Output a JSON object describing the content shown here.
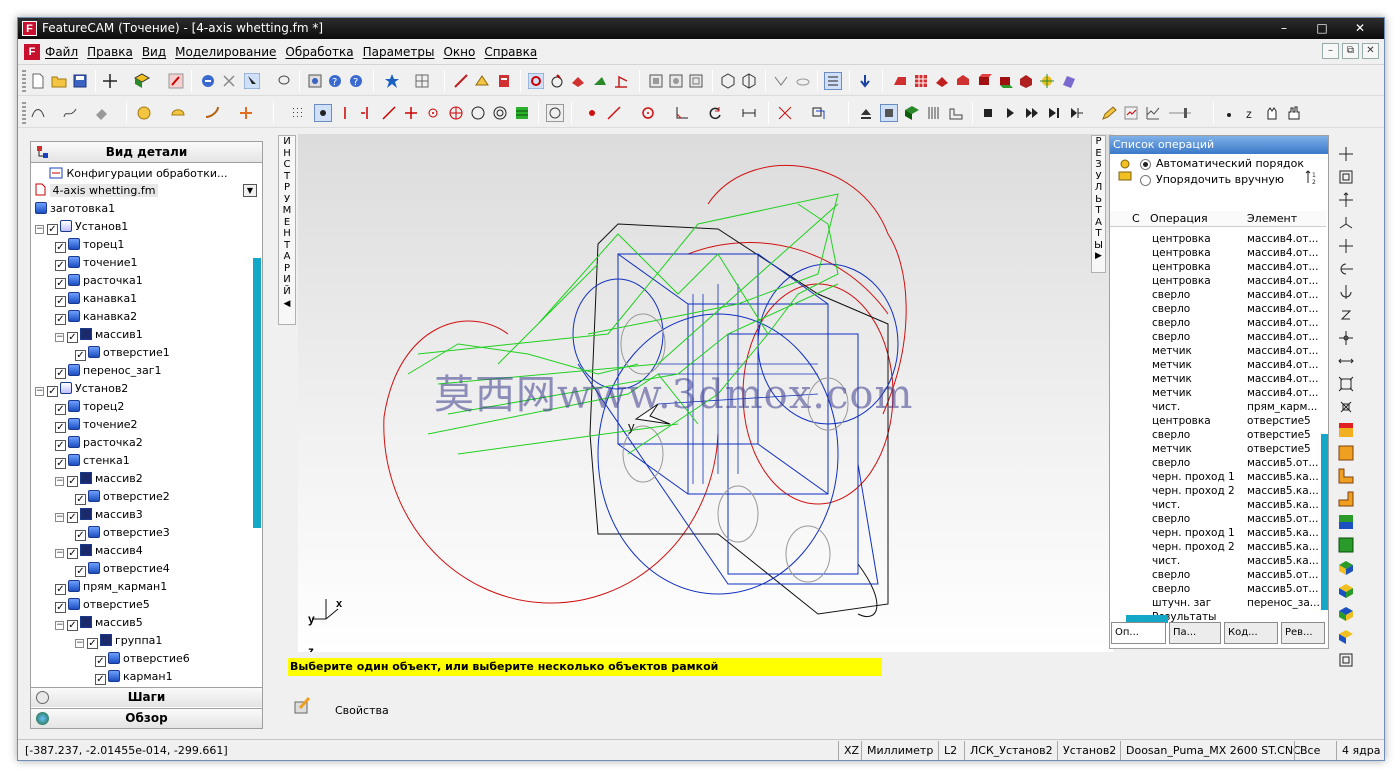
{
  "window": {
    "title": "FeatureCAM (Точение) - [4-axis whetting.fm *]",
    "app_icon": "F",
    "controls": {
      "minimize": "–",
      "maximize": "□",
      "close": "✕"
    }
  },
  "menu": {
    "items": [
      "Файл",
      "Правка",
      "Вид",
      "Моделирование",
      "Обработка",
      "Параметры",
      "Окно",
      "Справка"
    ],
    "mdi_controls": [
      "–",
      "⧉",
      "✕"
    ]
  },
  "left_panel": {
    "header": "Вид детали",
    "config_label": "Конфигурации обработки...",
    "file_selector": "4-axis whetting.fm",
    "tree": [
      {
        "label": "заготовка1",
        "level": 1,
        "kind": "stock"
      },
      {
        "label": "Установ1",
        "level": 1,
        "kind": "setup",
        "expand": "−"
      },
      {
        "label": "торец1",
        "level": 2,
        "kind": "feature"
      },
      {
        "label": "точение1",
        "level": 2,
        "kind": "feature"
      },
      {
        "label": "расточка1",
        "level": 2,
        "kind": "feature"
      },
      {
        "label": "канавка1",
        "level": 2,
        "kind": "feature"
      },
      {
        "label": "канавка2",
        "level": 2,
        "kind": "feature"
      },
      {
        "label": "массив1",
        "level": 2,
        "kind": "pattern",
        "expand": "−"
      },
      {
        "label": "отверстие1",
        "level": 3,
        "kind": "feature"
      },
      {
        "label": "перенос_заг1",
        "level": 2,
        "kind": "feature"
      },
      {
        "label": "Установ2",
        "level": 1,
        "kind": "setup",
        "expand": "−"
      },
      {
        "label": "торец2",
        "level": 2,
        "kind": "feature"
      },
      {
        "label": "точение2",
        "level": 2,
        "kind": "feature"
      },
      {
        "label": "расточка2",
        "level": 2,
        "kind": "feature"
      },
      {
        "label": "стенка1",
        "level": 2,
        "kind": "feature"
      },
      {
        "label": "массив2",
        "level": 2,
        "kind": "pattern",
        "expand": "−"
      },
      {
        "label": "отверстие2",
        "level": 3,
        "kind": "feature"
      },
      {
        "label": "массив3",
        "level": 2,
        "kind": "pattern",
        "expand": "−"
      },
      {
        "label": "отверстие3",
        "level": 3,
        "kind": "feature"
      },
      {
        "label": "массив4",
        "level": 2,
        "kind": "pattern",
        "expand": "−"
      },
      {
        "label": "отверстие4",
        "level": 3,
        "kind": "feature"
      },
      {
        "label": "прям_карман1",
        "level": 2,
        "kind": "feature"
      },
      {
        "label": "отверстие5",
        "level": 2,
        "kind": "feature"
      },
      {
        "label": "массив5",
        "level": 2,
        "kind": "pattern",
        "expand": "−"
      },
      {
        "label": "группа1",
        "level": 3,
        "kind": "group",
        "expand": "−"
      },
      {
        "label": "отверстие6",
        "level": 4,
        "kind": "feature"
      },
      {
        "label": "карман1",
        "level": 4,
        "kind": "feature"
      },
      {
        "label": "отверстие7",
        "level": 4,
        "kind": "feature"
      }
    ],
    "footer_steps": "Шаги",
    "footer_overview": "Обзор"
  },
  "vtab_left": "ИНСТРУМЕНТАРИЙ",
  "vtab_right": "РЕЗУЛЬТАТЫ",
  "viewport": {
    "axes": {
      "x": "x",
      "y": "y",
      "z": "z"
    },
    "watermark": "莫西网www.3dmox.com",
    "cursor_axis_label": "y"
  },
  "prompt": "Выберите один объект, или выберите несколько объектов рамкой",
  "properties_label": "Свойства",
  "operations_panel": {
    "title": "Список операций",
    "auto_order": "Автоматический порядок",
    "manual_order": "Упорядочить вручную",
    "columns": {
      "c": "С",
      "operation": "Операция",
      "element": "Элемент"
    },
    "rows": [
      {
        "op": "центровка",
        "el": "массив4.от..."
      },
      {
        "op": "центровка",
        "el": "массив4.от..."
      },
      {
        "op": "центровка",
        "el": "массив4.от..."
      },
      {
        "op": "центровка",
        "el": "массив4.от..."
      },
      {
        "op": "сверло",
        "el": "массив4.от..."
      },
      {
        "op": "сверло",
        "el": "массив4.от..."
      },
      {
        "op": "сверло",
        "el": "массив4.от..."
      },
      {
        "op": "сверло",
        "el": "массив4.от..."
      },
      {
        "op": "метчик",
        "el": "массив4.от..."
      },
      {
        "op": "метчик",
        "el": "массив4.от..."
      },
      {
        "op": "метчик",
        "el": "массив4.от..."
      },
      {
        "op": "метчик",
        "el": "массив4.от..."
      },
      {
        "op": "чист.",
        "el": "прям_карм..."
      },
      {
        "op": "центровка",
        "el": "отверстие5"
      },
      {
        "op": "сверло",
        "el": "отверстие5"
      },
      {
        "op": "метчик",
        "el": "отверстие5"
      },
      {
        "op": "сверло",
        "el": "массив5.от..."
      },
      {
        "op": "черн. проход 1",
        "el": "массив5.ка..."
      },
      {
        "op": "черн. проход 2",
        "el": "массив5.ка..."
      },
      {
        "op": "чист.",
        "el": "массив5.ка..."
      },
      {
        "op": "сверло",
        "el": "массив5.от..."
      },
      {
        "op": "черн. проход 1",
        "el": "массив5.ка..."
      },
      {
        "op": "черн. проход 2",
        "el": "массив5.ка..."
      },
      {
        "op": "чист.",
        "el": "массив5.ка..."
      },
      {
        "op": "сверло",
        "el": "массив5.от..."
      },
      {
        "op": "сверло",
        "el": "массив5.от..."
      },
      {
        "op": "штучн. заг",
        "el": "перенос_за..."
      },
      {
        "op": "Результаты",
        "el": ""
      }
    ],
    "tabs": [
      "Оп...",
      "Па...",
      "Код...",
      "Рев..."
    ]
  },
  "status_bar": {
    "coords": "[-387.237, -2.01455e-014, -299.661]",
    "plane": "XZ",
    "units": "Миллиметр",
    "level": "L2",
    "ucs": "ЛСК_Установ2",
    "setup": "Установ2",
    "machine": "Doosan_Puma_MX 2600 ST.CNC",
    "filter": "Все",
    "cores": "4 ядра"
  },
  "colors": {
    "accent_scroll": "#14a8c8",
    "prompt_bg": "#ffff00",
    "geom_red": "#d01010",
    "geom_blue": "#1030c0",
    "geom_green": "#20d020",
    "ops_header": "#3a78c8"
  }
}
